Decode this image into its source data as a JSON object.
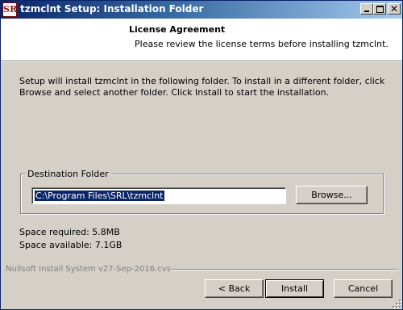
{
  "window": {
    "title": "tzmclnt Setup: Installation Folder",
    "app_icon_text": "SR",
    "close_symbol": "✕"
  },
  "header": {
    "title": "License Agreement",
    "subtitle": "Please review the license terms before installing tzmclnt."
  },
  "body": {
    "intro": "Setup will install tzmclnt in the following folder. To install in a different folder, click Browse and select another folder. Click Install to start the installation.",
    "destination": {
      "legend": "Destination Folder",
      "path": "C:\\Program Files\\SRL\\tzmclnt",
      "browse_label": "Browse..."
    },
    "space_required": "Space required: 5.8MB",
    "space_available": "Space available: 7.1GB"
  },
  "footer": {
    "branding": "Nullsoft Install System v27-Sep-2016.cvs",
    "back_label": "< Back",
    "install_label": "Install",
    "cancel_label": "Cancel"
  },
  "icons": [
    "app-icon",
    "minimize-icon",
    "maximize-icon",
    "close-icon",
    "resize-grip-icon"
  ],
  "colors": {
    "title_bar_start": "#0a246a",
    "title_bar_end": "#a6caf0",
    "dialog_face": "#d4d0c8",
    "selection": "#0a246a"
  }
}
